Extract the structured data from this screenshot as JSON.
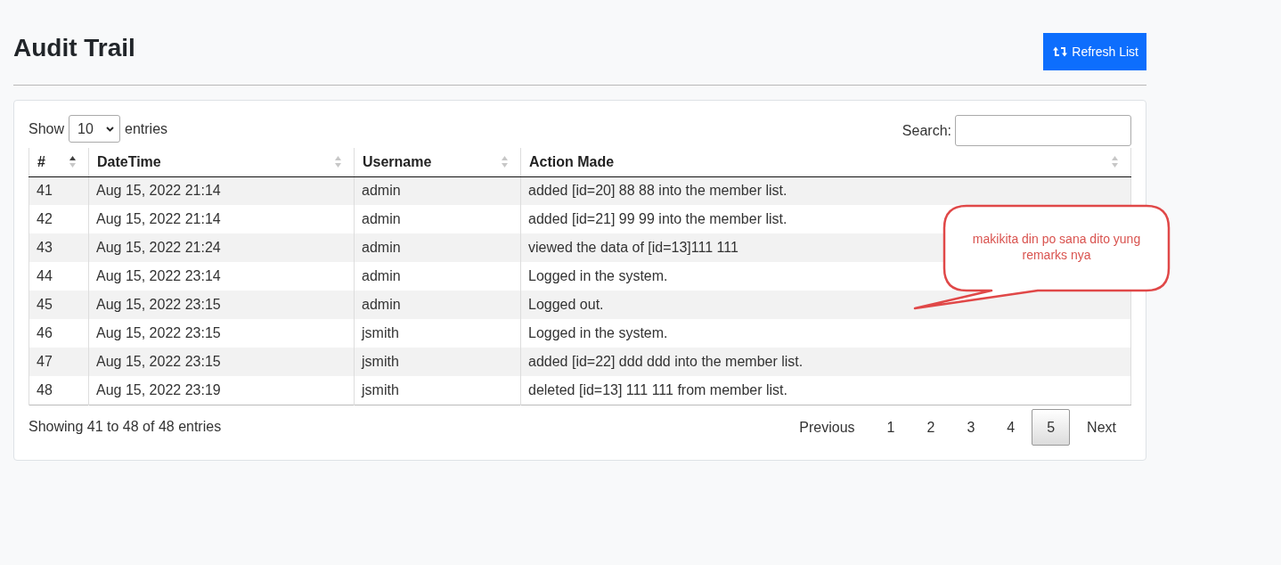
{
  "page": {
    "title": "Audit Trail",
    "refresh_button": "Refresh List"
  },
  "length_menu": {
    "label_before": "Show",
    "value": "10",
    "label_after": "entries"
  },
  "search": {
    "label": "Search:"
  },
  "table": {
    "columns": [
      {
        "label": "#",
        "sorted": true
      },
      {
        "label": "DateTime",
        "sorted": false
      },
      {
        "label": "Username",
        "sorted": false
      },
      {
        "label": "Action Made",
        "sorted": false
      }
    ],
    "rows": [
      [
        "41",
        "Aug 15, 2022 21:14",
        "admin",
        "added [id=20] 88 88 into the member list."
      ],
      [
        "42",
        "Aug 15, 2022 21:14",
        "admin",
        "added [id=21] 99 99 into the member list."
      ],
      [
        "43",
        "Aug 15, 2022 21:24",
        "admin",
        "viewed the data of [id=13]111 111"
      ],
      [
        "44",
        "Aug 15, 2022 23:14",
        "admin",
        "Logged in the system."
      ],
      [
        "45",
        "Aug 15, 2022 23:15",
        "admin",
        "Logged out."
      ],
      [
        "46",
        "Aug 15, 2022 23:15",
        "jsmith",
        "Logged in the system."
      ],
      [
        "47",
        "Aug 15, 2022 23:15",
        "jsmith",
        "added [id=22] ddd ddd into the member list."
      ],
      [
        "48",
        "Aug 15, 2022 23:19",
        "jsmith",
        "deleted [id=13] 111 111 from member list."
      ]
    ]
  },
  "info": "Showing 41 to 48 of 48 entries",
  "pagination": {
    "previous": "Previous",
    "pages": [
      {
        "label": "1",
        "selected": false
      },
      {
        "label": "2",
        "selected": false
      },
      {
        "label": "3",
        "selected": false
      },
      {
        "label": "4",
        "selected": false
      },
      {
        "label": "5",
        "selected": true
      }
    ],
    "next": "Next"
  },
  "callout": {
    "text": "makikita din po sana dito yung remarks nya"
  }
}
